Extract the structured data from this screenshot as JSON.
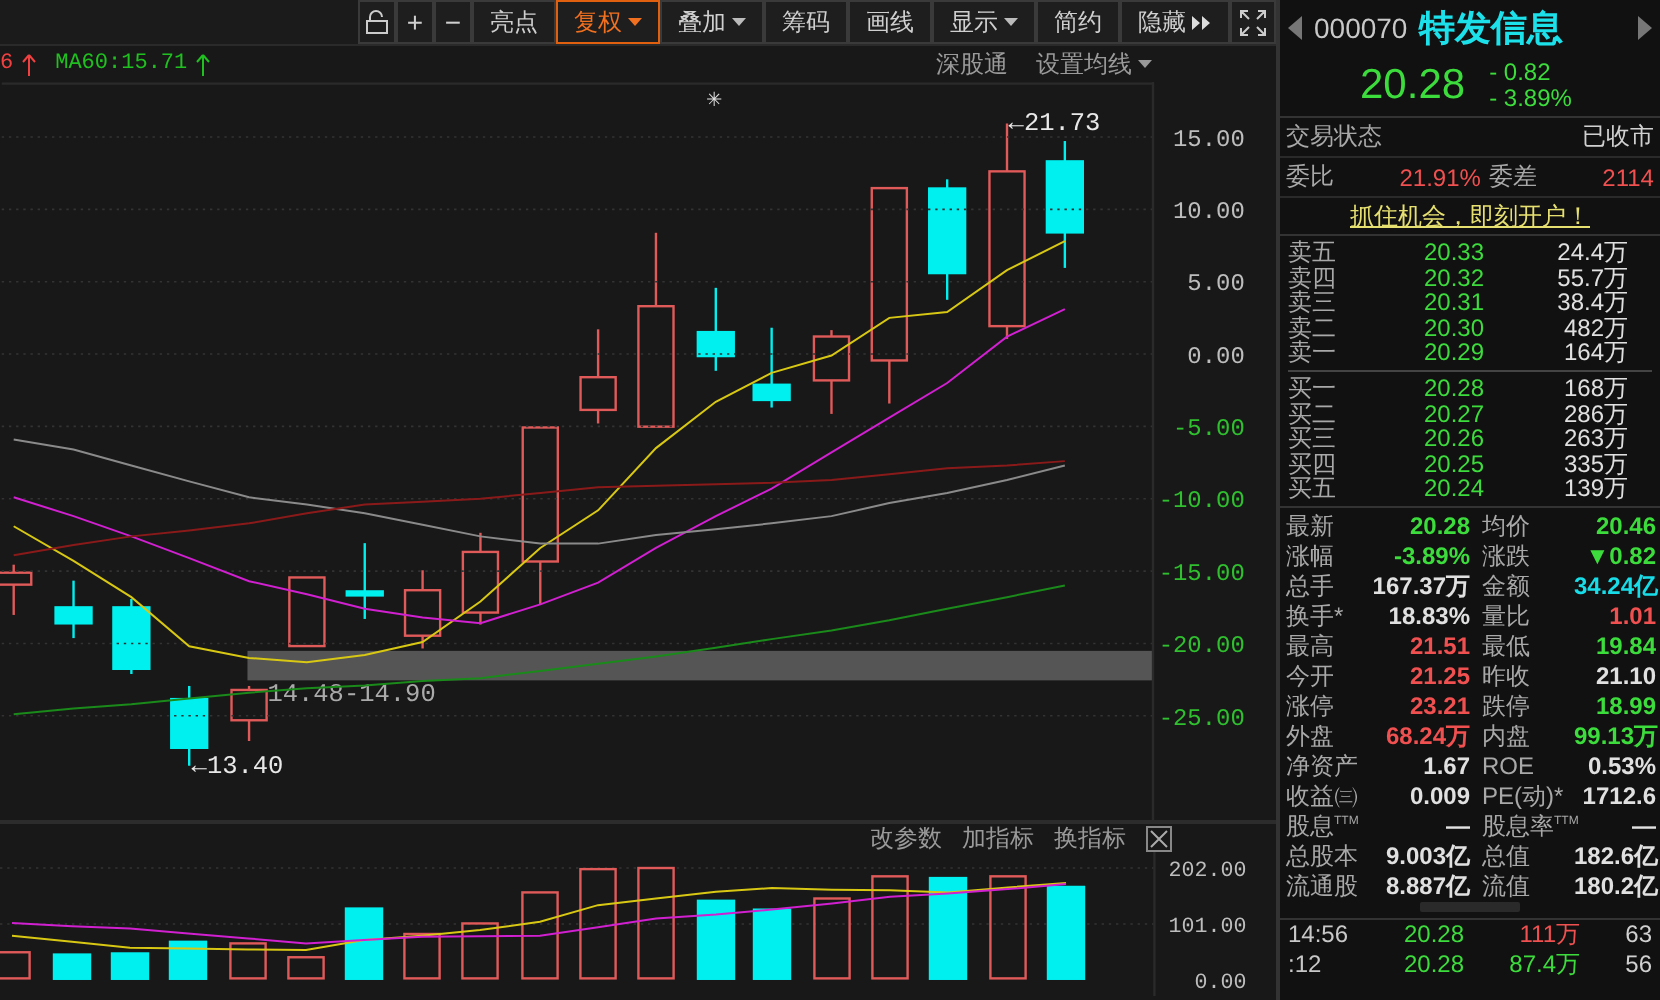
{
  "toolbar": {
    "buttons": [
      {
        "label": "+",
        "kind": "plain",
        "selected": false
      },
      {
        "label": "−",
        "kind": "plain",
        "selected": false
      },
      {
        "label": "亮点",
        "kind": "plain",
        "selected": false
      },
      {
        "label": "复权",
        "kind": "dropdown",
        "selected": true
      },
      {
        "label": "叠加",
        "kind": "dropdown",
        "selected": false
      },
      {
        "label": "筹码",
        "kind": "plain",
        "selected": false
      },
      {
        "label": "画线",
        "kind": "plain",
        "selected": false
      },
      {
        "label": "显示",
        "kind": "dropdown",
        "selected": false
      },
      {
        "label": "简约",
        "kind": "plain",
        "selected": false
      },
      {
        "label": "隐藏",
        "kind": "expand",
        "selected": false
      }
    ]
  },
  "chart": {
    "indicators": [
      {
        "text": "6",
        "color": "#f04040"
      },
      {
        "text": "MA60:15.71",
        "color": "#20c020"
      }
    ],
    "links": [
      "深股通",
      "设置均线"
    ],
    "marker": "✳",
    "high_label": "←21.73",
    "low_label": "←13.40",
    "band_label": "14.48-14.90",
    "chart_data": {
      "type": "line",
      "grid": true,
      "ylim": [
        -32.2,
        18.8
      ],
      "yticks": [
        {
          "value": 15,
          "label": "15.00"
        },
        {
          "value": 10,
          "label": "10.00"
        },
        {
          "value": 5,
          "label": "5.00"
        },
        {
          "value": 0,
          "label": "0.00"
        },
        {
          "value": -5,
          "label": "-5.00"
        },
        {
          "value": -10,
          "label": "-10.00"
        },
        {
          "value": -15,
          "label": "-15.00"
        },
        {
          "value": -20,
          "label": "-20.00"
        },
        {
          "value": -25,
          "label": "-25.00"
        }
      ],
      "series": [
        {
          "color": "#d8c814",
          "values": [
            -11.9,
            -14.3,
            -16.8,
            -20.2,
            -21.0,
            -21.3,
            -20.8,
            -19.9,
            -17.1,
            -13.4,
            -10.8,
            -6.5,
            -3.3,
            -1.3,
            -0.1,
            2.5,
            2.9,
            5.8,
            7.8
          ]
        },
        {
          "color": "#d020d0",
          "values": [
            -9.9,
            -11.2,
            -12.6,
            -14.1,
            -15.7,
            -16.6,
            -17.6,
            -18.2,
            -18.6,
            -17.3,
            -15.8,
            -13.4,
            -11.2,
            -9.3,
            -6.8,
            -4.4,
            -2.0,
            1.2,
            3.1
          ]
        },
        {
          "color": "#8a8a8a",
          "values": [
            -5.9,
            -6.6,
            -7.7,
            -8.8,
            -9.9,
            -10.4,
            -11.0,
            -11.8,
            -12.6,
            -13.1,
            -13.1,
            -12.5,
            -12.1,
            -11.7,
            -11.2,
            -10.3,
            -9.6,
            -8.7,
            -7.7
          ]
        },
        {
          "color": "#8a1a1a",
          "values": [
            -13.9,
            -13.2,
            -12.6,
            -12.2,
            -11.7,
            -11.0,
            -10.4,
            -10.2,
            -10.0,
            -9.6,
            -9.2,
            -9.1,
            -9.0,
            -8.9,
            -8.7,
            -8.3,
            -7.9,
            -7.7,
            -7.4
          ]
        },
        {
          "color": "#1a8a1a",
          "values": [
            -24.9,
            -24.5,
            -24.2,
            -23.8,
            -23.4,
            -23.1,
            -22.9,
            -22.6,
            -22.4,
            -21.9,
            -21.4,
            -20.9,
            -20.3,
            -19.7,
            -19.1,
            -18.4,
            -17.6,
            -16.8,
            -16.0
          ]
        }
      ]
    }
  },
  "volume": {
    "actions": [
      "改参数",
      "加指标",
      "换指标"
    ],
    "chart_data": {
      "type": "bar",
      "grid": true,
      "ylim": [
        -28.9,
        230.9
      ],
      "yticks": [
        {
          "value": 202,
          "label": "202.00"
        },
        {
          "value": 101,
          "label": "101.00"
        },
        {
          "value": 0,
          "label": "0.00"
        }
      ],
      "series": [
        {
          "color": "#e05a5a",
          "values": [
            50,
            null,
            null,
            null,
            66,
            41,
            null,
            83,
            102,
            158,
            200,
            202,
            null,
            null,
            147,
            187,
            null,
            187,
            null
          ]
        },
        {
          "color": "#00f0f0",
          "values": [
            null,
            48,
            50,
            71,
            null,
            null,
            131,
            null,
            null,
            null,
            null,
            null,
            145,
            129,
            null,
            null,
            186,
            null,
            170
          ]
        },
        {
          "type": "line",
          "color": "#d8c814",
          "values": [
            80,
            69,
            58,
            57,
            55,
            54,
            72,
            80,
            90,
            105,
            135,
            147,
            159,
            166,
            163,
            162,
            158,
            167,
            175
          ]
        },
        {
          "type": "line",
          "color": "#d020d0",
          "values": [
            103,
            97,
            93,
            84,
            75,
            66,
            72,
            78,
            79,
            80,
            95,
            111,
            118,
            127,
            138,
            150,
            156,
            164,
            173
          ]
        }
      ]
    }
  },
  "quote": {
    "code": "000070",
    "name": "特发信息",
    "price": "20.28",
    "change": "- 0.82",
    "change_pct": "- 3.89%",
    "status_label": "交易状态",
    "status": "已收市",
    "ratio_label": "委比",
    "ratio": "21.91%",
    "diff_label": "委差",
    "diff": "2114",
    "promo": "抓住机会，即刻开户！",
    "asks": [
      {
        "label": "卖五",
        "price": "20.33",
        "volume": "24.4万"
      },
      {
        "label": "卖四",
        "price": "20.32",
        "volume": "55.7万"
      },
      {
        "label": "卖三",
        "price": "20.31",
        "volume": "38.4万"
      },
      {
        "label": "卖二",
        "price": "20.30",
        "volume": "482万"
      },
      {
        "label": "卖一",
        "price": "20.29",
        "volume": "164万"
      }
    ],
    "bids": [
      {
        "label": "买一",
        "price": "20.28",
        "volume": "168万"
      },
      {
        "label": "买二",
        "price": "20.27",
        "volume": "286万"
      },
      {
        "label": "买三",
        "price": "20.26",
        "volume": "263万"
      },
      {
        "label": "买四",
        "price": "20.25",
        "volume": "335万"
      },
      {
        "label": "买五",
        "price": "20.24",
        "volume": "139万"
      }
    ],
    "stats": [
      {
        "label": "最新",
        "value": "20.28",
        "color": "#3ddc3d"
      },
      {
        "label": "均价",
        "value": "20.46",
        "color": "#3ddc3d"
      },
      {
        "label": "涨幅",
        "value": "-3.89%",
        "color": "#3ddc3d"
      },
      {
        "label": "涨跌",
        "value": "▼0.82",
        "color": "#3ddc3d"
      },
      {
        "label": "总手",
        "value": "167.37万",
        "color": "#e0e0e0"
      },
      {
        "label": "金额",
        "value": "34.24亿",
        "color": "#18dce8"
      },
      {
        "label": "换手*",
        "value": "18.83%",
        "color": "#e0e0e0"
      },
      {
        "label": "量比",
        "value": "1.01",
        "color": "#f05050"
      },
      {
        "label": "最高",
        "value": "21.51",
        "color": "#f05050"
      },
      {
        "label": "最低",
        "value": "19.84",
        "color": "#3ddc3d"
      },
      {
        "label": "今开",
        "value": "21.25",
        "color": "#f05050"
      },
      {
        "label": "昨收",
        "value": "21.10",
        "color": "#e0e0e0"
      },
      {
        "label": "涨停",
        "value": "23.21",
        "color": "#f05050"
      },
      {
        "label": "跌停",
        "value": "18.99",
        "color": "#3ddc3d"
      },
      {
        "label": "外盘",
        "value": "68.24万",
        "color": "#f05050"
      },
      {
        "label": "内盘",
        "value": "99.13万",
        "color": "#3ddc3d"
      },
      {
        "label": "净资产",
        "value": "1.67",
        "color": "#e0e0e0"
      },
      {
        "label": "ROE",
        "value": "0.53%",
        "color": "#e0e0e0"
      },
      {
        "label": "收益㈢",
        "value": "0.009",
        "color": "#e0e0e0"
      },
      {
        "label": "PE(动)*",
        "value": "1712.6",
        "color": "#e0e0e0"
      },
      {
        "label": "股息$^{TTM}$",
        "value": "—",
        "color": "#e0e0e0"
      },
      {
        "label": "股息率$^{TTM}$",
        "value": "—",
        "color": "#e0e0e0"
      },
      {
        "label": "总股本",
        "value": "9.003亿",
        "color": "#e0e0e0"
      },
      {
        "label": "总值",
        "value": "182.6亿",
        "color": "#e0e0e0"
      },
      {
        "label": "流通股",
        "value": "8.887亿",
        "color": "#e0e0e0"
      },
      {
        "label": "流值",
        "value": "180.2亿",
        "color": "#e0e0e0"
      }
    ],
    "trades": [
      {
        "time": "14:56",
        "price": "20.28",
        "volume": "111万",
        "count": "63",
        "color": "#f05050"
      },
      {
        "time": ":12",
        "price": "20.28",
        "volume": "87.4万",
        "count": "56",
        "color": "#3ddc3d"
      }
    ]
  }
}
